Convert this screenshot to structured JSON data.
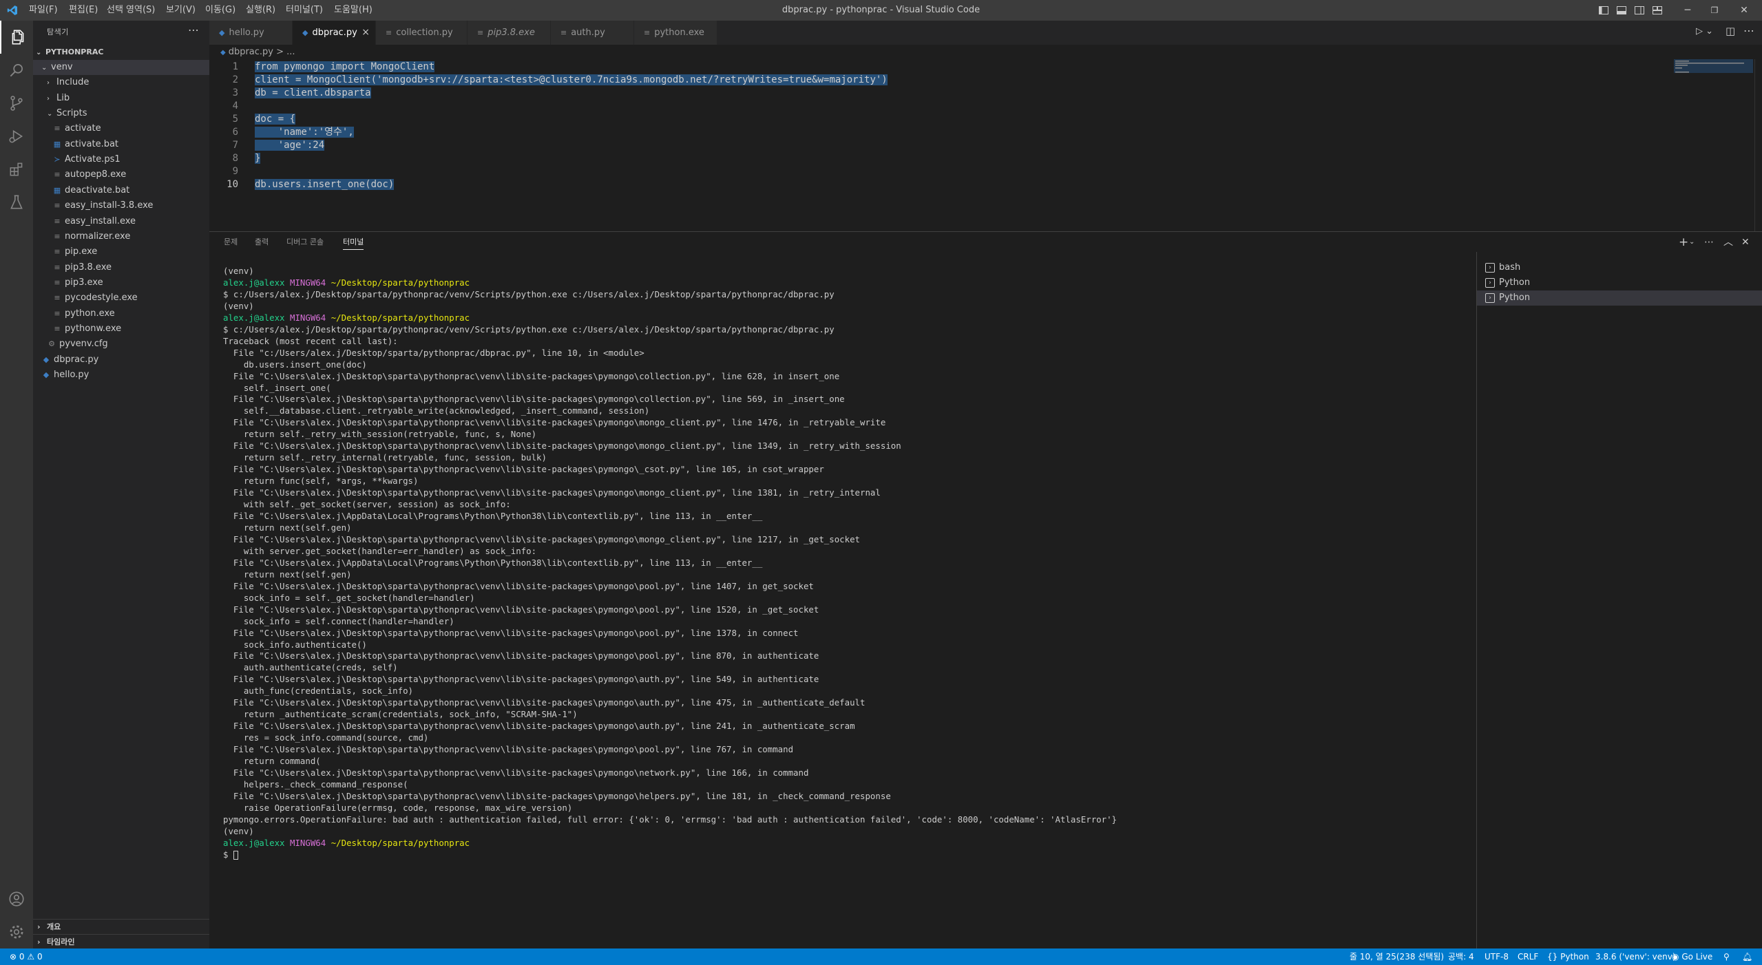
{
  "titlebar": {
    "title": "dbprac.py - pythonprac - Visual Studio Code",
    "menu": [
      "파일(F)",
      "편집(E)",
      "선택 영역(S)",
      "보기(V)",
      "이동(G)",
      "실행(R)",
      "터미널(T)",
      "도움말(H)"
    ]
  },
  "sidebar": {
    "title": "탐색기",
    "root": "PYTHONPRAC",
    "tree": [
      {
        "label": "venv",
        "type": "folder-open"
      },
      {
        "label": "Include",
        "type": "folder"
      },
      {
        "label": "Lib",
        "type": "folder"
      },
      {
        "label": "Scripts",
        "type": "folder-open"
      },
      {
        "label": "activate",
        "type": "file"
      },
      {
        "label": "activate.bat",
        "type": "bat"
      },
      {
        "label": "Activate.ps1",
        "type": "ps1"
      },
      {
        "label": "autopep8.exe",
        "type": "file"
      },
      {
        "label": "deactivate.bat",
        "type": "bat"
      },
      {
        "label": "easy_install-3.8.exe",
        "type": "file"
      },
      {
        "label": "easy_install.exe",
        "type": "file"
      },
      {
        "label": "normalizer.exe",
        "type": "file"
      },
      {
        "label": "pip.exe",
        "type": "file"
      },
      {
        "label": "pip3.8.exe",
        "type": "file"
      },
      {
        "label": "pip3.exe",
        "type": "file"
      },
      {
        "label": "pycodestyle.exe",
        "type": "file"
      },
      {
        "label": "python.exe",
        "type": "file"
      },
      {
        "label": "pythonw.exe",
        "type": "file"
      },
      {
        "label": "pyvenv.cfg",
        "type": "gear"
      },
      {
        "label": "dbprac.py",
        "type": "py"
      },
      {
        "label": "hello.py",
        "type": "py"
      }
    ],
    "outline": "개요",
    "timeline": "타임라인"
  },
  "tabs": [
    {
      "label": "hello.py"
    },
    {
      "label": "dbprac.py"
    },
    {
      "label": "collection.py"
    },
    {
      "label": "pip3.8.exe"
    },
    {
      "label": "auth.py"
    },
    {
      "label": "python.exe"
    }
  ],
  "breadcrumb": "dbprac.py > ...",
  "editor": {
    "line_numbers": [
      "1",
      "2",
      "3",
      "4",
      "5",
      "6",
      "7",
      "8",
      "9",
      "10"
    ],
    "code": [
      "from pymongo import MongoClient",
      "client = MongoClient('mongodb+srv://sparta:<test>@cluster0.7ncia9s.mongodb.net/?retryWrites=true&w=majority')",
      "db = client.dbsparta",
      "",
      "doc = {",
      "    'name':'영수',",
      "    'age':24",
      "}",
      "",
      "db.users.insert_one(doc)"
    ]
  },
  "panel": {
    "tabs": [
      "문제",
      "출력",
      "디버그 콘솔",
      "터미널"
    ],
    "terminals": [
      "bash",
      "Python",
      "Python"
    ],
    "lines": [
      "(venv)",
      "@@PROMPT",
      "$ c:/Users/alex.j/Desktop/sparta/pythonprac/venv/Scripts/python.exe c:/Users/alex.j/Desktop/sparta/pythonprac/dbprac.py",
      "(venv)",
      "@@PROMPT",
      "$ c:/Users/alex.j/Desktop/sparta/pythonprac/venv/Scripts/python.exe c:/Users/alex.j/Desktop/sparta/pythonprac/dbprac.py",
      "Traceback (most recent call last):",
      "  File \"c:/Users/alex.j/Desktop/sparta/pythonprac/dbprac.py\", line 10, in <module>",
      "    db.users.insert_one(doc)",
      "  File \"C:\\Users\\alex.j\\Desktop\\sparta\\pythonprac\\venv\\lib\\site-packages\\pymongo\\collection.py\", line 628, in insert_one",
      "    self._insert_one(",
      "  File \"C:\\Users\\alex.j\\Desktop\\sparta\\pythonprac\\venv\\lib\\site-packages\\pymongo\\collection.py\", line 569, in _insert_one",
      "    self.__database.client._retryable_write(acknowledged, _insert_command, session)",
      "  File \"C:\\Users\\alex.j\\Desktop\\sparta\\pythonprac\\venv\\lib\\site-packages\\pymongo\\mongo_client.py\", line 1476, in _retryable_write",
      "    return self._retry_with_session(retryable, func, s, None)",
      "  File \"C:\\Users\\alex.j\\Desktop\\sparta\\pythonprac\\venv\\lib\\site-packages\\pymongo\\mongo_client.py\", line 1349, in _retry_with_session",
      "    return self._retry_internal(retryable, func, session, bulk)",
      "  File \"C:\\Users\\alex.j\\Desktop\\sparta\\pythonprac\\venv\\lib\\site-packages\\pymongo\\_csot.py\", line 105, in csot_wrapper",
      "    return func(self, *args, **kwargs)",
      "  File \"C:\\Users\\alex.j\\Desktop\\sparta\\pythonprac\\venv\\lib\\site-packages\\pymongo\\mongo_client.py\", line 1381, in _retry_internal",
      "    with self._get_socket(server, session) as sock_info:",
      "  File \"C:\\Users\\alex.j\\AppData\\Local\\Programs\\Python\\Python38\\lib\\contextlib.py\", line 113, in __enter__",
      "    return next(self.gen)",
      "  File \"C:\\Users\\alex.j\\Desktop\\sparta\\pythonprac\\venv\\lib\\site-packages\\pymongo\\mongo_client.py\", line 1217, in _get_socket",
      "    with server.get_socket(handler=err_handler) as sock_info:",
      "  File \"C:\\Users\\alex.j\\AppData\\Local\\Programs\\Python\\Python38\\lib\\contextlib.py\", line 113, in __enter__",
      "    return next(self.gen)",
      "  File \"C:\\Users\\alex.j\\Desktop\\sparta\\pythonprac\\venv\\lib\\site-packages\\pymongo\\pool.py\", line 1407, in get_socket",
      "    sock_info = self._get_socket(handler=handler)",
      "  File \"C:\\Users\\alex.j\\Desktop\\sparta\\pythonprac\\venv\\lib\\site-packages\\pymongo\\pool.py\", line 1520, in _get_socket",
      "    sock_info = self.connect(handler=handler)",
      "  File \"C:\\Users\\alex.j\\Desktop\\sparta\\pythonprac\\venv\\lib\\site-packages\\pymongo\\pool.py\", line 1378, in connect",
      "    sock_info.authenticate()",
      "  File \"C:\\Users\\alex.j\\Desktop\\sparta\\pythonprac\\venv\\lib\\site-packages\\pymongo\\pool.py\", line 870, in authenticate",
      "    auth.authenticate(creds, self)",
      "  File \"C:\\Users\\alex.j\\Desktop\\sparta\\pythonprac\\venv\\lib\\site-packages\\pymongo\\auth.py\", line 549, in authenticate",
      "    auth_func(credentials, sock_info)",
      "  File \"C:\\Users\\alex.j\\Desktop\\sparta\\pythonprac\\venv\\lib\\site-packages\\pymongo\\auth.py\", line 475, in _authenticate_default",
      "    return _authenticate_scram(credentials, sock_info, \"SCRAM-SHA-1\")",
      "  File \"C:\\Users\\alex.j\\Desktop\\sparta\\pythonprac\\venv\\lib\\site-packages\\pymongo\\auth.py\", line 241, in _authenticate_scram",
      "    res = sock_info.command(source, cmd)",
      "  File \"C:\\Users\\alex.j\\Desktop\\sparta\\pythonprac\\venv\\lib\\site-packages\\pymongo\\pool.py\", line 767, in command",
      "    return command(",
      "  File \"C:\\Users\\alex.j\\Desktop\\sparta\\pythonprac\\venv\\lib\\site-packages\\pymongo\\network.py\", line 166, in command",
      "    helpers._check_command_response(",
      "  File \"C:\\Users\\alex.j\\Desktop\\sparta\\pythonprac\\venv\\lib\\site-packages\\pymongo\\helpers.py\", line 181, in _check_command_response",
      "    raise OperationFailure(errmsg, code, response, max_wire_version)",
      "pymongo.errors.OperationFailure: bad auth : authentication failed, full error: {'ok': 0, 'errmsg': 'bad auth : authentication failed', 'code': 8000, 'codeName': 'AtlasError'}",
      "(venv)",
      "@@PROMPT",
      "$ "
    ],
    "prompt_user": "alex.j@alexx",
    "prompt_shell": "MINGW64",
    "prompt_path": "~/Desktop/sparta/pythonprac"
  },
  "statusbar": {
    "errors": "0",
    "warnings": "0",
    "position": "줄 10, 열 25(238 선택됨)",
    "spaces": "공백: 4",
    "encoding": "UTF-8",
    "eol": "CRLF",
    "language": "Python",
    "interpreter": "3.8.6 ('venv': venv)",
    "golive": "Go Live"
  },
  "colors": {
    "accent": "#007acc",
    "editor_bg": "#1e1e1e",
    "sidebar_bg": "#252526",
    "selection": "#264f78"
  }
}
